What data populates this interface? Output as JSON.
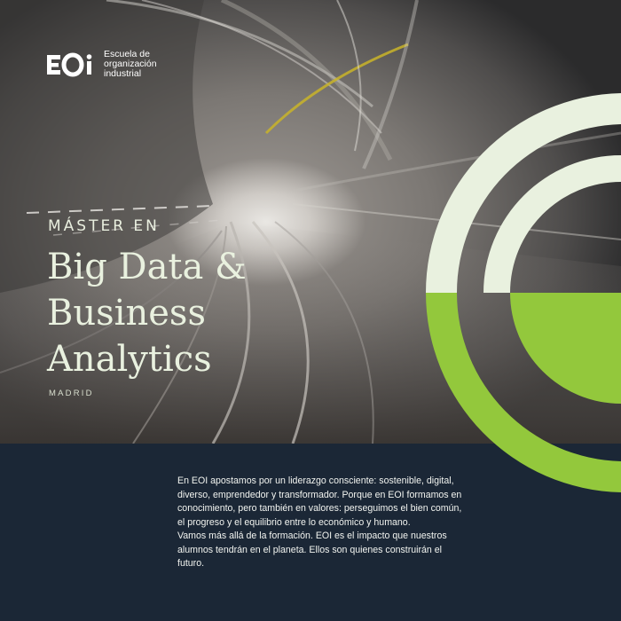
{
  "logo": {
    "mark": "EOI",
    "lines": [
      "Escuela de",
      "organización",
      "industrial"
    ]
  },
  "hero": {
    "overline": "MÁSTER EN",
    "title_lines": [
      "Big Data &",
      "Business",
      "Analytics"
    ],
    "location": "MADRID"
  },
  "body": {
    "paragraph_1": "En EOI apostamos por un liderazgo consciente: sostenible, digital, diverso, emprendedor y transformador. Porque en EOI formamos en conocimiento, pero también en valores: perseguimos el bien común, el progreso y el equilibrio entre lo económico y humano.",
    "paragraph_2": "Vamos más allá de la formación. EOI es el impacto que nuestros alumnos tendrán en el planeta. Ellos son quienes construirán el futuro."
  },
  "colors": {
    "navy": "#1b2736",
    "pale_green": "#e9f1df",
    "lime_green": "#93c83c"
  }
}
